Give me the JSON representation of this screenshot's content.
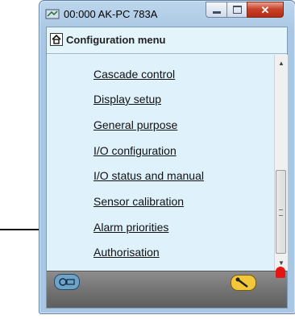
{
  "window": {
    "title": "00:000 AK-PC 783A",
    "controls": {
      "minimize": "minimize",
      "maximize": "maximize",
      "close": "✕"
    }
  },
  "header": {
    "title": "Configuration menu"
  },
  "menu": {
    "items": [
      "Cascade control",
      "Display setup",
      "General purpose",
      "I/O configuration",
      "I/O status and manual",
      "Sensor calibration",
      "Alarm priorities",
      "Authorisation"
    ],
    "highlighted_item": "Alarm priorities"
  },
  "scrollbar": {
    "up": "▲",
    "down": "▼"
  },
  "footer": {
    "icons": [
      "status-icon",
      "tool-icon",
      "alarm-bell-icon"
    ]
  },
  "colors": {
    "client_bg": "#dff2fb",
    "footer_bg": "#707070",
    "alarm": "#e61414"
  }
}
